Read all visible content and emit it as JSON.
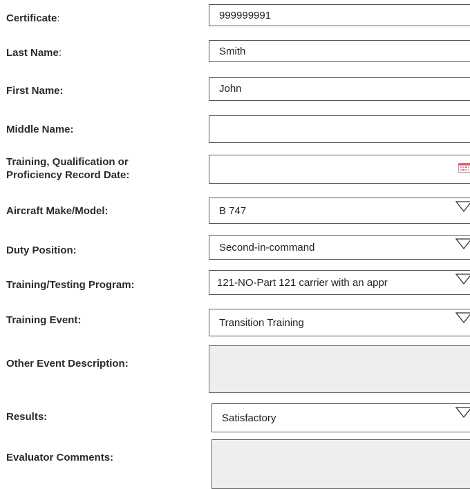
{
  "form": {
    "certificate": {
      "label": "Certificate",
      "colon": ":",
      "value": "999999991"
    },
    "last_name": {
      "label": "Last Name",
      "colon": ":",
      "value": "Smith"
    },
    "first_name": {
      "label": "First Name:",
      "value": "John"
    },
    "middle_name": {
      "label": "Middle Name:",
      "value": ""
    },
    "record_date": {
      "label_line1": "Training, Qualification or",
      "label_line2": "Proficiency Record Date:",
      "value": "",
      "icon": "calendar-icon"
    },
    "aircraft": {
      "label": "Aircraft Make/Model:",
      "value": "B 747",
      "icon": "dropdown-arrow-icon"
    },
    "duty_position": {
      "label": "Duty Position:",
      "value": "Second-in-command",
      "icon": "dropdown-arrow-icon"
    },
    "program": {
      "label": "Training/Testing Program:",
      "value": "121-NO-Part 121 carrier with  an appr",
      "icon": "dropdown-arrow-icon"
    },
    "event": {
      "label": "Training Event:",
      "value": "Transition Training",
      "icon": "dropdown-arrow-icon"
    },
    "other_event": {
      "label": "Other Event Description:",
      "value": ""
    },
    "results": {
      "label": "Results:",
      "value": "Satisfactory",
      "icon": "dropdown-arrow-icon"
    },
    "comments": {
      "label": "Evaluator Comments:",
      "value": ""
    }
  },
  "colors": {
    "field_border": "#555555",
    "disabled_fill": "#eeeeee",
    "calendar_red": "#e05a6a",
    "calendar_blue": "#7b8fd8"
  }
}
